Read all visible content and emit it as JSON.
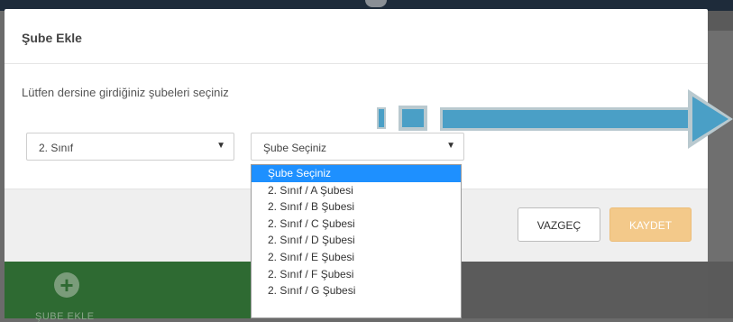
{
  "modal": {
    "title": "Şube Ekle",
    "instruction": "Lütfen dersine girdiğiniz şubeleri seçiniz"
  },
  "class_select": {
    "value": "2. Sınıf"
  },
  "branch_select": {
    "value": "Şube Seçiniz",
    "options": [
      "Şube Seçiniz",
      "2. Sınıf / A Şubesi",
      "2. Sınıf / B Şubesi",
      "2. Sınıf / C Şubesi",
      "2. Sınıf / D Şubesi",
      "2. Sınıf / E Şubesi",
      "2. Sınıf / F Şubesi",
      "2. Sınıf / G Şubesi"
    ],
    "selected_index": 0
  },
  "footer": {
    "cancel_label": "VAZGEÇ",
    "save_label": "KAYDET"
  },
  "background": {
    "tile_label": "ŞUBE EKLE"
  },
  "colors": {
    "selected_option": "#1e90ff",
    "save_button": "#f3c98a",
    "annotation_arrow": "#4a9fc6",
    "background_tile": "#2e6a32"
  }
}
